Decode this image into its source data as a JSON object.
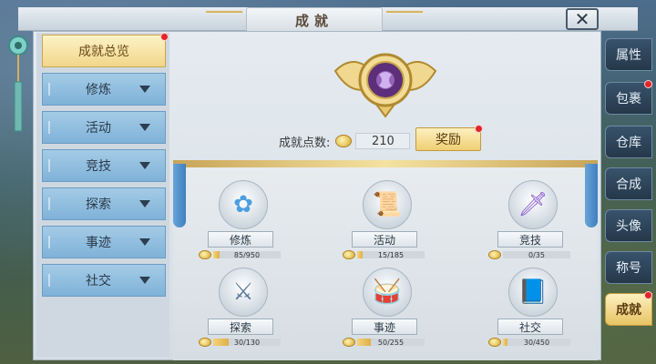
{
  "window": {
    "title": "成就",
    "close_glyph": "✕"
  },
  "left_nav": {
    "items": [
      {
        "label": "成就总览",
        "active": true,
        "has_arrow": false,
        "badge": true
      },
      {
        "label": "修炼",
        "active": false,
        "has_arrow": true,
        "badge": false
      },
      {
        "label": "活动",
        "active": false,
        "has_arrow": true,
        "badge": false
      },
      {
        "label": "竞技",
        "active": false,
        "has_arrow": true,
        "badge": false
      },
      {
        "label": "探索",
        "active": false,
        "has_arrow": true,
        "badge": false
      },
      {
        "label": "事迹",
        "active": false,
        "has_arrow": true,
        "badge": false
      },
      {
        "label": "社交",
        "active": false,
        "has_arrow": true,
        "badge": false
      }
    ]
  },
  "summary": {
    "points_label": "成就点数:",
    "points_value": "210",
    "reward_label": "奖励"
  },
  "categories": [
    {
      "label": "修炼",
      "progress": "85/950",
      "fraction": 0.089,
      "icon": "lotus-icon",
      "glyph": "✿"
    },
    {
      "label": "活动",
      "progress": "15/185",
      "fraction": 0.081,
      "icon": "scroll-icon",
      "glyph": "📜"
    },
    {
      "label": "竞技",
      "progress": "0/35",
      "fraction": 0.0,
      "icon": "sword-icon",
      "glyph": "🗡"
    },
    {
      "label": "探索",
      "progress": "30/130",
      "fraction": 0.23,
      "icon": "crossed-swords-icon",
      "glyph": "⚔"
    },
    {
      "label": "事迹",
      "progress": "50/255",
      "fraction": 0.196,
      "icon": "drum-icon",
      "glyph": "🥁"
    },
    {
      "label": "社交",
      "progress": "30/450",
      "fraction": 0.067,
      "icon": "book-quill-icon",
      "glyph": "📘"
    }
  ],
  "right_tabs": [
    {
      "label": "属性",
      "active": false,
      "badge": false
    },
    {
      "label": "包裹",
      "active": false,
      "badge": true
    },
    {
      "label": "仓库",
      "active": false,
      "badge": false
    },
    {
      "label": "合成",
      "active": false,
      "badge": false
    },
    {
      "label": "头像",
      "active": false,
      "badge": false
    },
    {
      "label": "称号",
      "active": false,
      "badge": false
    },
    {
      "label": "成就",
      "active": true,
      "badge": true
    }
  ],
  "colors": {
    "nav_active": "#f1d68a",
    "nav_inactive": "#7fb2d8",
    "badge_red": "#e0262a",
    "tab_dark": "#25384a"
  }
}
